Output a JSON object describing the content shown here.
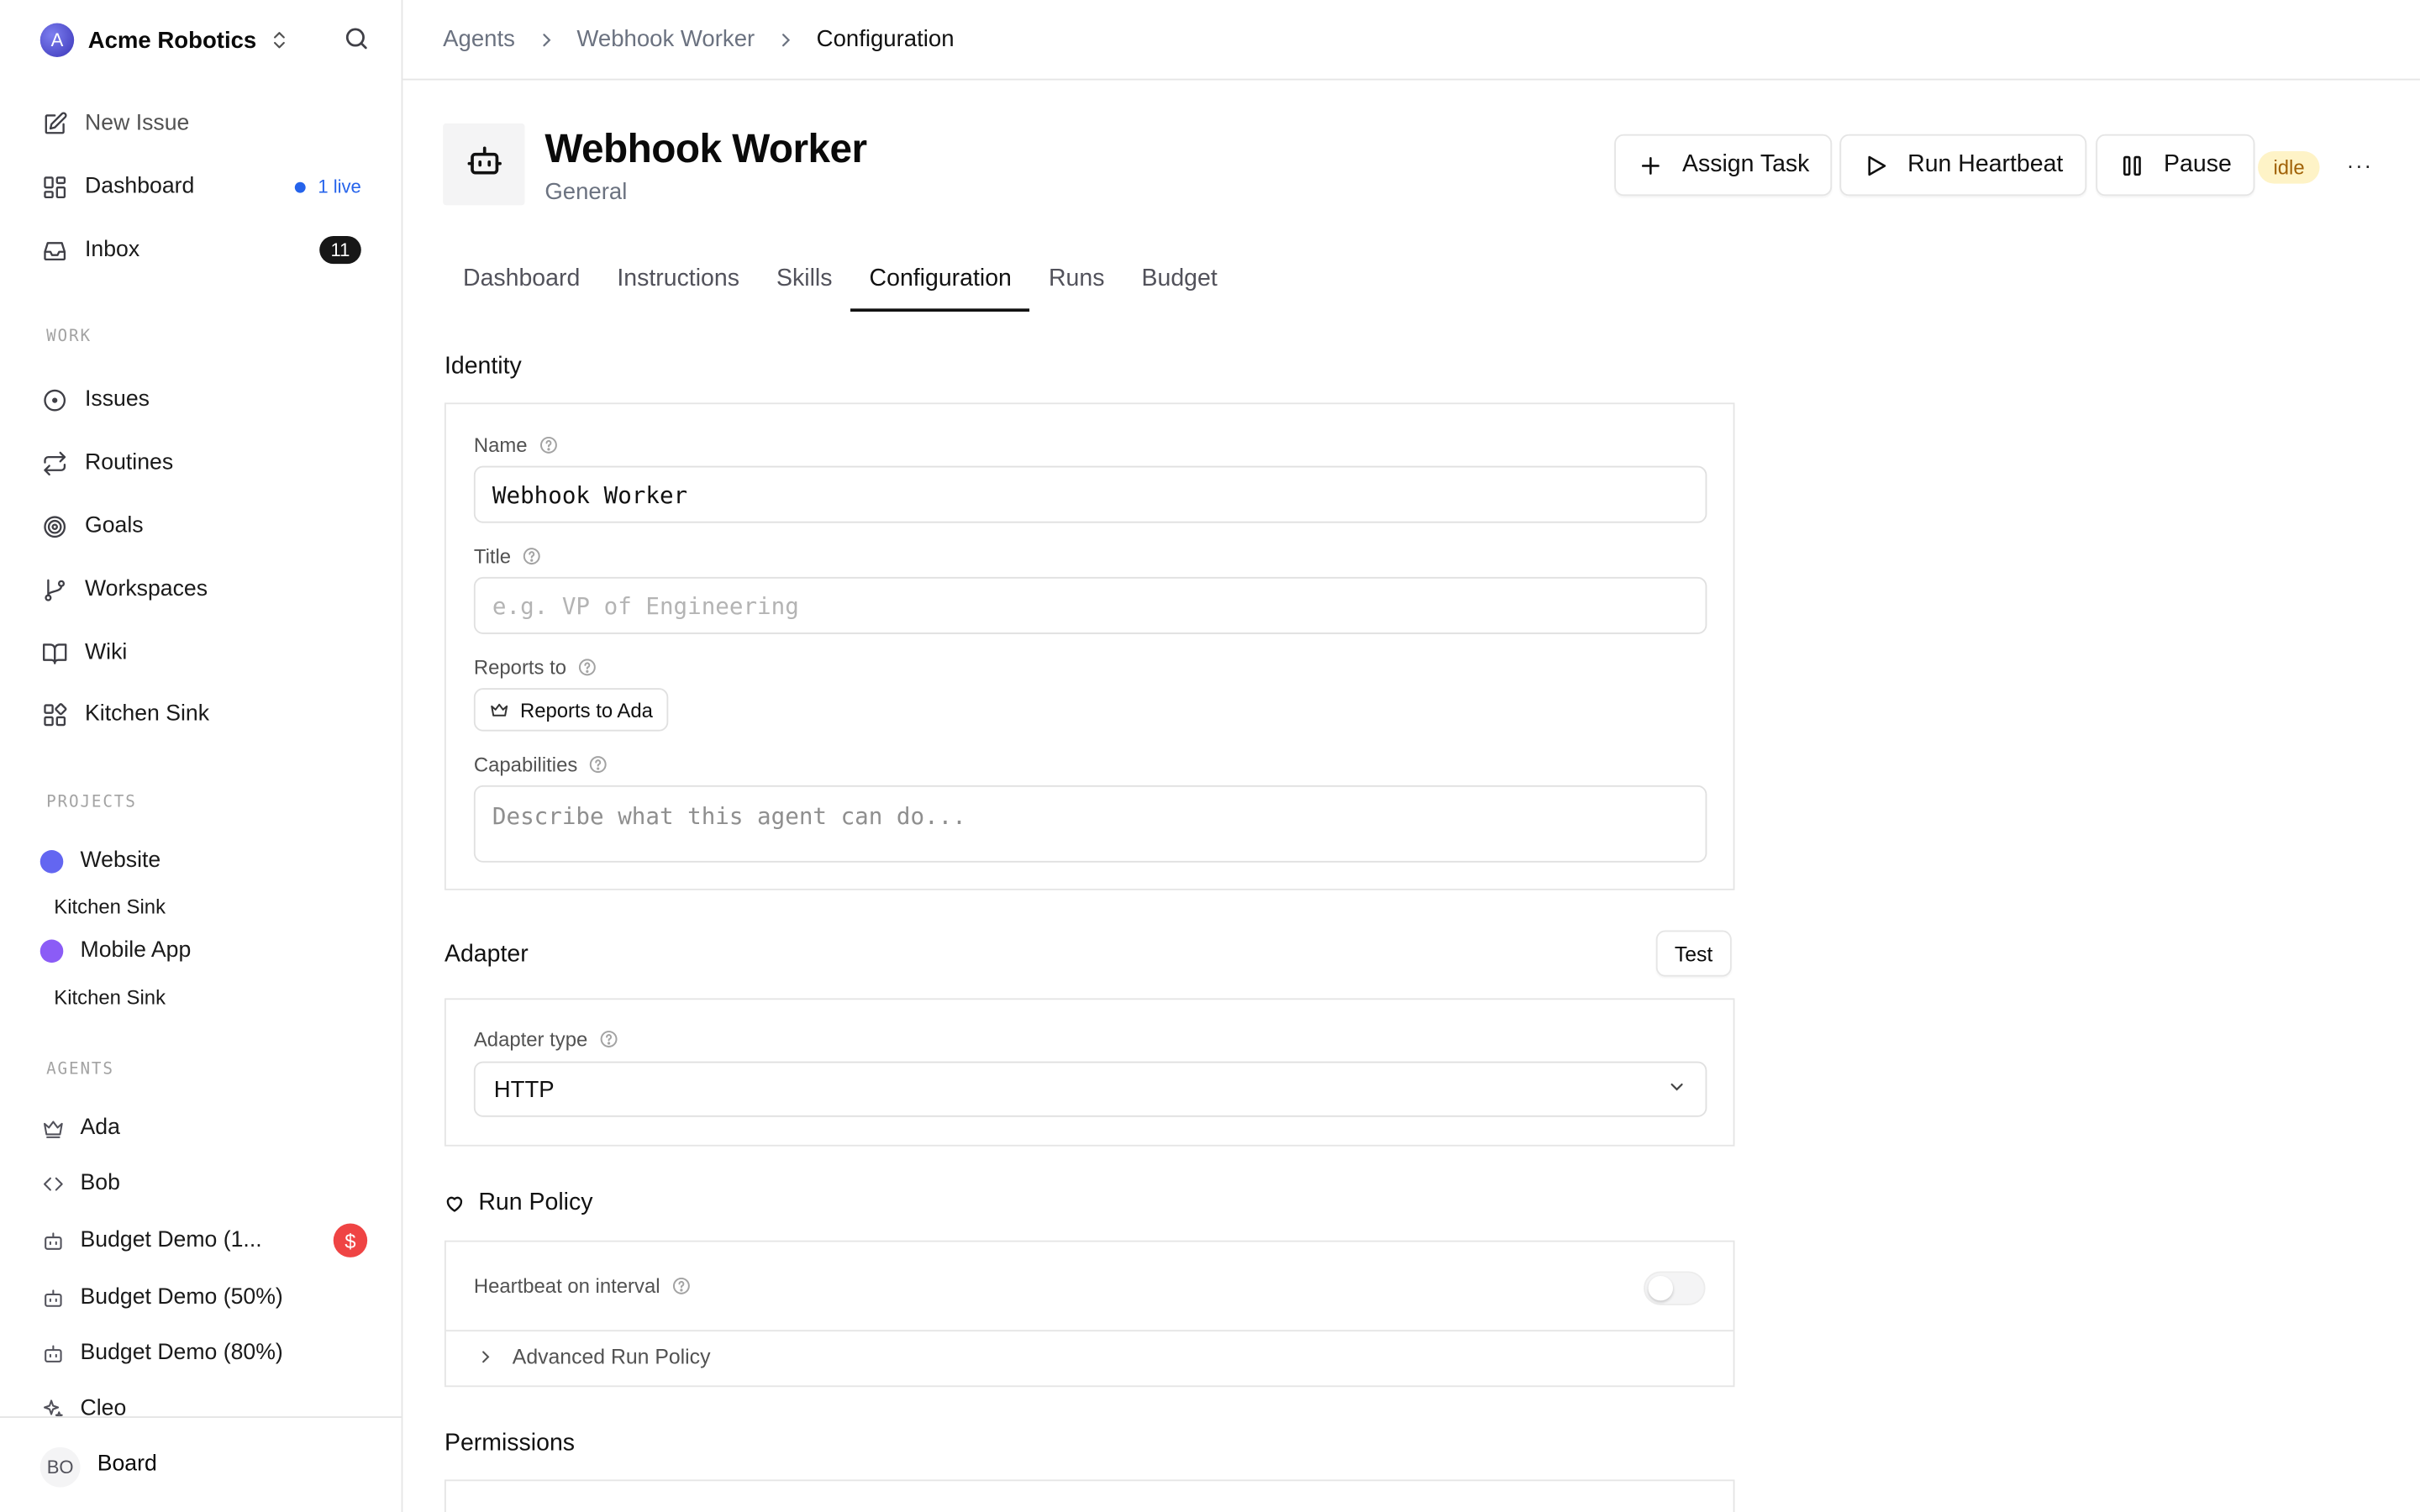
{
  "sidebar": {
    "company": "Acme Robotics",
    "logo_letter": "A",
    "nav": [
      {
        "label": "New Issue",
        "icon": "edit-icon"
      },
      {
        "label": "Dashboard",
        "icon": "dashboard-icon",
        "badge": "1 live"
      },
      {
        "label": "Inbox",
        "icon": "inbox-icon",
        "count": "11"
      }
    ],
    "work_label": "WORK",
    "work": [
      {
        "label": "Issues"
      },
      {
        "label": "Routines"
      },
      {
        "label": "Goals"
      },
      {
        "label": "Workspaces"
      },
      {
        "label": "Wiki"
      },
      {
        "label": "Kitchen Sink"
      }
    ],
    "projects_label": "PROJECTS",
    "projects": [
      {
        "label": "Website",
        "color": "#6366f1",
        "sub": "Kitchen Sink"
      },
      {
        "label": "Mobile App",
        "color": "#8b5cf6",
        "sub": "Kitchen Sink"
      }
    ],
    "agents_label": "AGENTS",
    "agents": [
      {
        "label": "Ada",
        "icon": "crown-icon"
      },
      {
        "label": "Bob",
        "icon": "code-icon"
      },
      {
        "label": "Budget Demo (1...",
        "icon": "bot-icon",
        "badge": "$"
      },
      {
        "label": "Budget Demo (50%)",
        "icon": "bot-icon"
      },
      {
        "label": "Budget Demo (80%)",
        "icon": "bot-icon"
      },
      {
        "label": "Cleo",
        "icon": "sparkle-icon"
      }
    ],
    "footer": {
      "initials": "BO",
      "name": "Board"
    }
  },
  "breadcrumb": [
    "Agents",
    "Webhook Worker",
    "Configuration"
  ],
  "header": {
    "title": "Webhook Worker",
    "subtitle": "General",
    "assign_label": "Assign Task",
    "heartbeat_label": "Run Heartbeat",
    "pause_label": "Pause",
    "status": "idle",
    "more": "···"
  },
  "tabs": [
    "Dashboard",
    "Instructions",
    "Skills",
    "Configuration",
    "Runs",
    "Budget"
  ],
  "active_tab": "Configuration",
  "identity": {
    "heading": "Identity",
    "name_label": "Name",
    "name_value": "Webhook Worker",
    "title_label": "Title",
    "title_placeholder": "e.g. VP of Engineering",
    "reports_label": "Reports to",
    "reports_value": "Reports to Ada",
    "capabilities_label": "Capabilities",
    "capabilities_placeholder": "Describe what this agent can do..."
  },
  "adapter": {
    "heading": "Adapter",
    "test_label": "Test",
    "type_label": "Adapter type",
    "type_value": "HTTP"
  },
  "run_policy": {
    "heading": "Run Policy",
    "heartbeat_label": "Heartbeat on interval",
    "heartbeat_enabled": false,
    "advanced_label": "Advanced Run Policy"
  },
  "permissions": {
    "heading": "Permissions"
  }
}
